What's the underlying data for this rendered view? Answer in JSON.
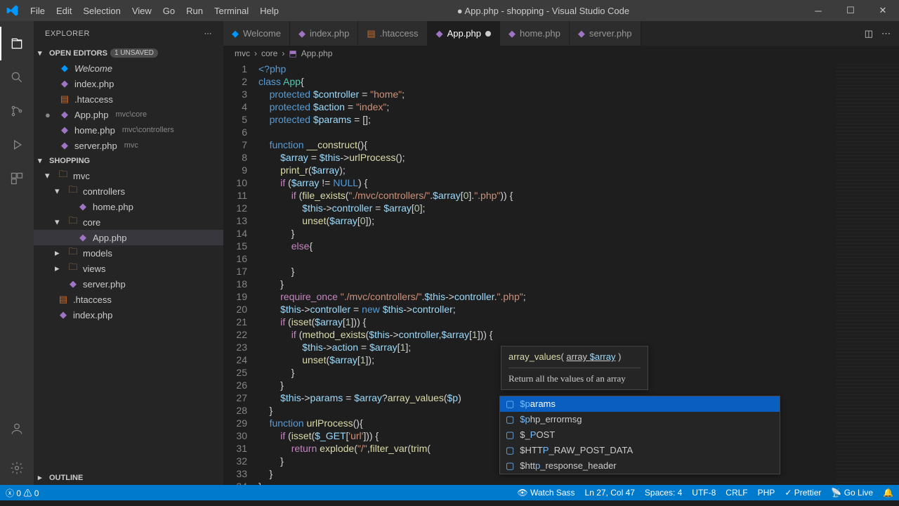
{
  "window": {
    "title": "● App.php - shopping - Visual Studio Code"
  },
  "menu": [
    "File",
    "Edit",
    "Selection",
    "View",
    "Go",
    "Run",
    "Terminal",
    "Help"
  ],
  "explorer": {
    "title": "EXPLORER",
    "open_editors": {
      "label": "OPEN EDITORS",
      "unsaved_badge": "1 UNSAVED"
    },
    "editors": [
      {
        "icon": "vs",
        "name": "Welcome",
        "path": ""
      },
      {
        "icon": "php",
        "name": "index.php",
        "path": ""
      },
      {
        "icon": "ht",
        "name": ".htaccess",
        "path": ""
      },
      {
        "icon": "php",
        "name": "App.php",
        "path": "mvc\\core",
        "modified": true
      },
      {
        "icon": "php",
        "name": "home.php",
        "path": "mvc\\controllers"
      },
      {
        "icon": "php",
        "name": "server.php",
        "path": "mvc"
      }
    ],
    "project": {
      "label": "SHOPPING"
    },
    "tree": [
      {
        "type": "folder",
        "name": "mvc",
        "depth": 0,
        "open": true
      },
      {
        "type": "folder",
        "name": "controllers",
        "depth": 1,
        "open": true
      },
      {
        "type": "file",
        "name": "home.php",
        "depth": 2,
        "icon": "php"
      },
      {
        "type": "folder",
        "name": "core",
        "depth": 1,
        "open": true
      },
      {
        "type": "file",
        "name": "App.php",
        "depth": 2,
        "icon": "php",
        "active": true
      },
      {
        "type": "folder",
        "name": "models",
        "depth": 1,
        "open": false
      },
      {
        "type": "folder",
        "name": "views",
        "depth": 1,
        "open": false
      },
      {
        "type": "file",
        "name": "server.php",
        "depth": 1,
        "icon": "php"
      },
      {
        "type": "file",
        "name": ".htaccess",
        "depth": 0,
        "icon": "ht"
      },
      {
        "type": "file",
        "name": "index.php",
        "depth": 0,
        "icon": "php"
      }
    ],
    "outline": {
      "label": "OUTLINE"
    }
  },
  "tabs": [
    {
      "icon": "vs",
      "label": "Welcome"
    },
    {
      "icon": "php",
      "label": "index.php"
    },
    {
      "icon": "ht",
      "label": ".htaccess"
    },
    {
      "icon": "php",
      "label": "App.php",
      "active": true,
      "modified": true
    },
    {
      "icon": "php",
      "label": "home.php"
    },
    {
      "icon": "php",
      "label": "server.php"
    }
  ],
  "breadcrumb": [
    "mvc",
    "core",
    "App.php"
  ],
  "code_lines": 34,
  "signature_help": {
    "sig": "array_values( array $array )",
    "doc": "Return all the values of an array"
  },
  "suggestions": [
    {
      "label": "$params",
      "sel": true,
      "match": "$p"
    },
    {
      "label": "$php_errormsg",
      "match": "$p"
    },
    {
      "label": "$_POST",
      "match": "P"
    },
    {
      "label": "$HTTP_RAW_POST_DATA",
      "match": "P"
    },
    {
      "label": "$http_response_header",
      "match": "p"
    }
  ],
  "status": {
    "errors": "0",
    "warnings": "0",
    "watch": "Watch Sass",
    "pos": "Ln 27, Col 47",
    "spaces": "Spaces: 4",
    "enc": "UTF-8",
    "eol": "CRLF",
    "lang": "PHP",
    "prettier": "Prettier",
    "golive": "Go Live",
    "bell": ""
  }
}
